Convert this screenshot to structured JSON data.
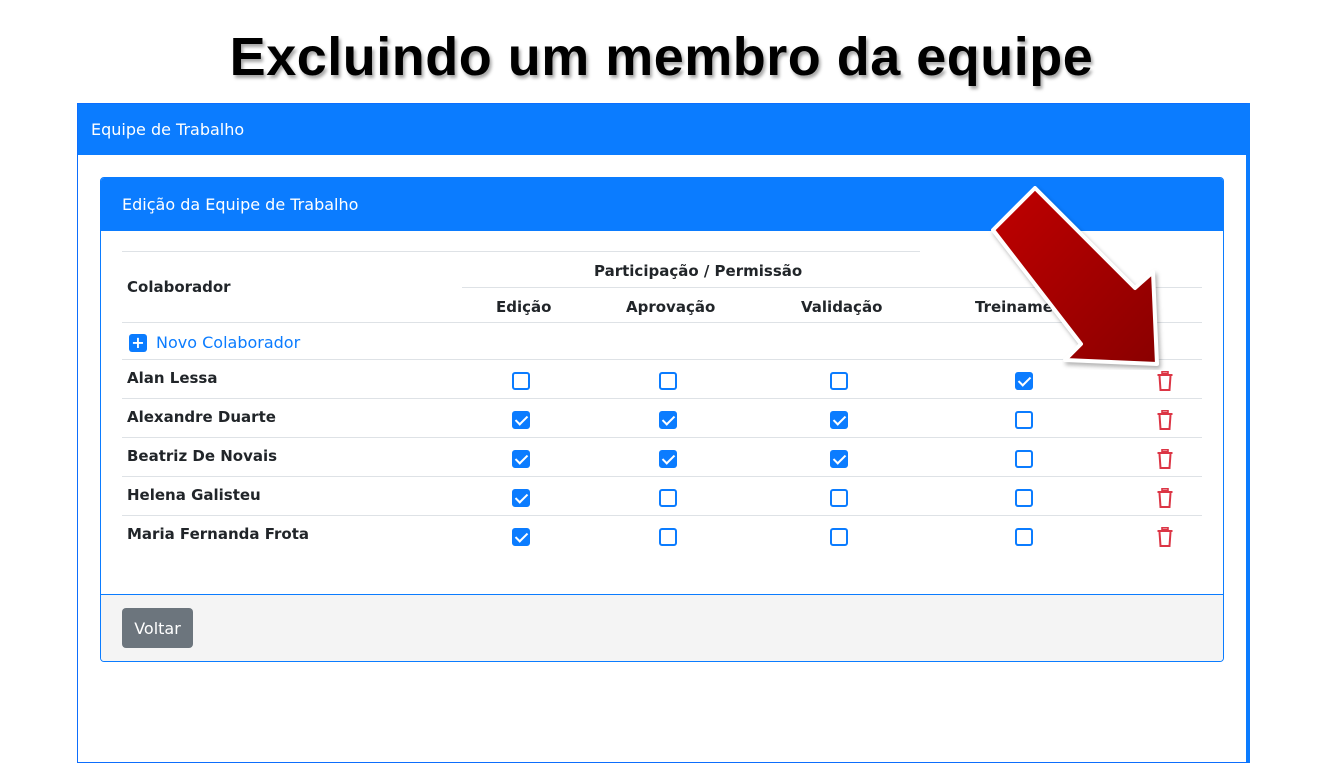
{
  "slide": {
    "title": "Excluindo um membro da equipe"
  },
  "outer": {
    "header": "Equipe de Trabalho"
  },
  "card": {
    "header": "Edição da Equipe de Trabalho",
    "table": {
      "col_collaborator": "Colaborador",
      "group_header": "Participação / Permissão",
      "columns": [
        "Edição",
        "Aprovação",
        "Validação",
        "Treinamento"
      ],
      "new_collaborator": "Novo Colaborador",
      "rows": [
        {
          "name": "Alan Lessa",
          "perms": [
            false,
            false,
            false,
            true
          ]
        },
        {
          "name": "Alexandre Duarte",
          "perms": [
            true,
            true,
            true,
            false
          ]
        },
        {
          "name": "Beatriz De Novais",
          "perms": [
            true,
            true,
            true,
            false
          ]
        },
        {
          "name": "Helena Galisteu",
          "perms": [
            true,
            false,
            false,
            false
          ]
        },
        {
          "name": "Maria Fernanda Frota",
          "perms": [
            true,
            false,
            false,
            false
          ]
        }
      ]
    },
    "footer": {
      "back_label": "Voltar"
    }
  },
  "icons": {
    "delete": "trash-icon",
    "add": "plus-square-icon",
    "annotation": "red-arrow-icon"
  },
  "colors": {
    "primary": "#0b7cff",
    "danger": "#dc3545",
    "secondary": "#6c757d",
    "arrow": "#a00000"
  }
}
